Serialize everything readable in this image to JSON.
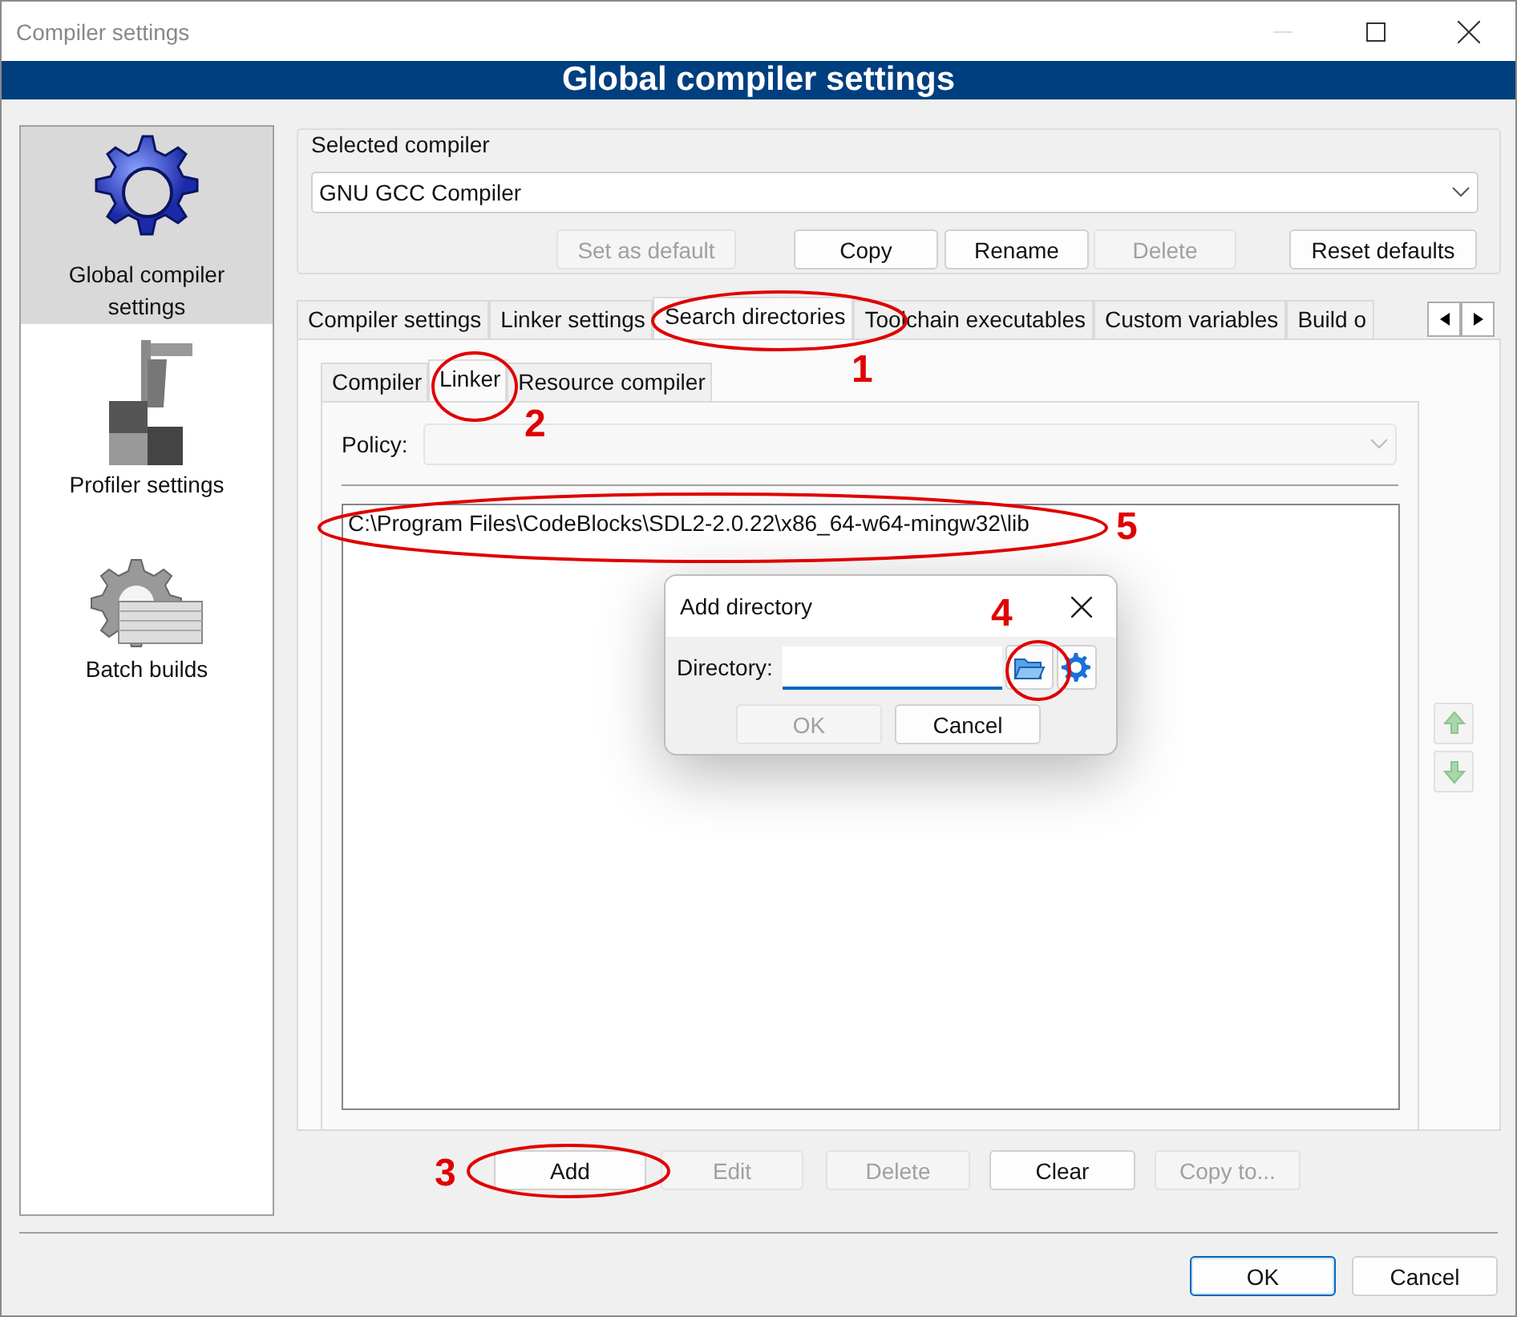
{
  "window": {
    "title": "Compiler settings"
  },
  "banner": "Global compiler settings",
  "sidebar": {
    "items": [
      {
        "label": "Global compiler settings",
        "selected": true
      },
      {
        "label": "Profiler settings",
        "selected": false
      },
      {
        "label": "Batch builds",
        "selected": false
      }
    ]
  },
  "selected_compiler": {
    "label": "Selected compiler",
    "value": "GNU GCC Compiler",
    "buttons": [
      {
        "label": "Set as default",
        "disabled": true
      },
      {
        "label": "Copy",
        "disabled": false
      },
      {
        "label": "Rename",
        "disabled": false
      },
      {
        "label": "Delete",
        "disabled": true
      },
      {
        "label": "Reset defaults",
        "disabled": false
      }
    ]
  },
  "tabs": [
    {
      "label": "Compiler settings",
      "selected": false
    },
    {
      "label": "Linker settings",
      "selected": false
    },
    {
      "label": "Search directories",
      "selected": true
    },
    {
      "label": "Toolchain executables",
      "selected": false
    },
    {
      "label": "Custom variables",
      "selected": false
    },
    {
      "label": "Build o",
      "selected": false
    }
  ],
  "subtabs": [
    {
      "label": "Compiler",
      "selected": false
    },
    {
      "label": "Linker",
      "selected": true
    },
    {
      "label": "Resource compiler",
      "selected": false
    }
  ],
  "policy": {
    "label": "Policy:",
    "disabled": true
  },
  "directories": [
    "C:\\Program Files\\CodeBlocks\\SDL2-2.0.22\\x86_64-w64-mingw32\\lib"
  ],
  "list_buttons": [
    {
      "label": "Add",
      "disabled": false
    },
    {
      "label": "Edit",
      "disabled": true
    },
    {
      "label": "Delete",
      "disabled": true
    },
    {
      "label": "Clear",
      "disabled": false
    },
    {
      "label": "Copy to...",
      "disabled": true
    }
  ],
  "dialog": {
    "title": "Add directory",
    "field_label": "Directory:",
    "buttons": [
      {
        "label": "OK",
        "disabled": true
      },
      {
        "label": "Cancel",
        "disabled": false
      }
    ]
  },
  "footer_buttons": [
    {
      "label": "OK",
      "default": true
    },
    {
      "label": "Cancel",
      "default": false
    }
  ],
  "annotations": [
    {
      "label": "1"
    },
    {
      "label": "2"
    },
    {
      "label": "3"
    },
    {
      "label": "4"
    },
    {
      "label": "5"
    }
  ]
}
